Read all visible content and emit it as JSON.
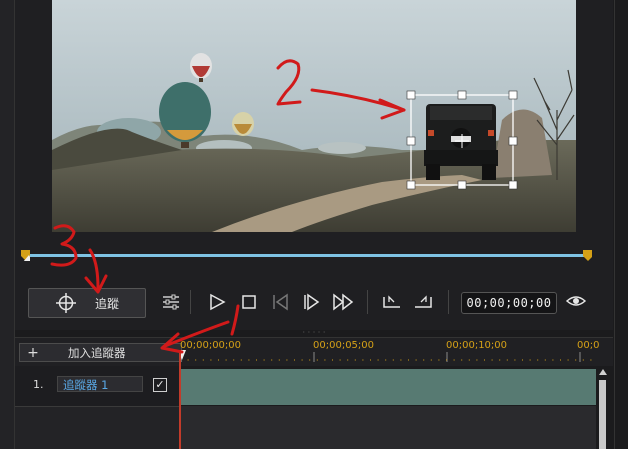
{
  "controls": {
    "track_button_label": "追蹤",
    "timecode": "00;00;00;00"
  },
  "timeline": {
    "add_tracker_label": "加入追蹤器",
    "ruler_labels": [
      "00;00;00;00",
      "00;00;05;00",
      "00;00;10;00",
      "00;0"
    ],
    "tracks": [
      {
        "index": "1.",
        "name": "追蹤器 1",
        "checked": true
      }
    ]
  },
  "annotations": {
    "numbers": [
      "1",
      "2",
      "3"
    ],
    "color": "#d11a1a"
  },
  "colors": {
    "scrubber": "#7fc3e4",
    "marker": "#d4a017",
    "ruler_text": "#d4a017",
    "track_name": "#5aa9e6",
    "lane": "#577a72",
    "playhead": "#c23b2a"
  }
}
